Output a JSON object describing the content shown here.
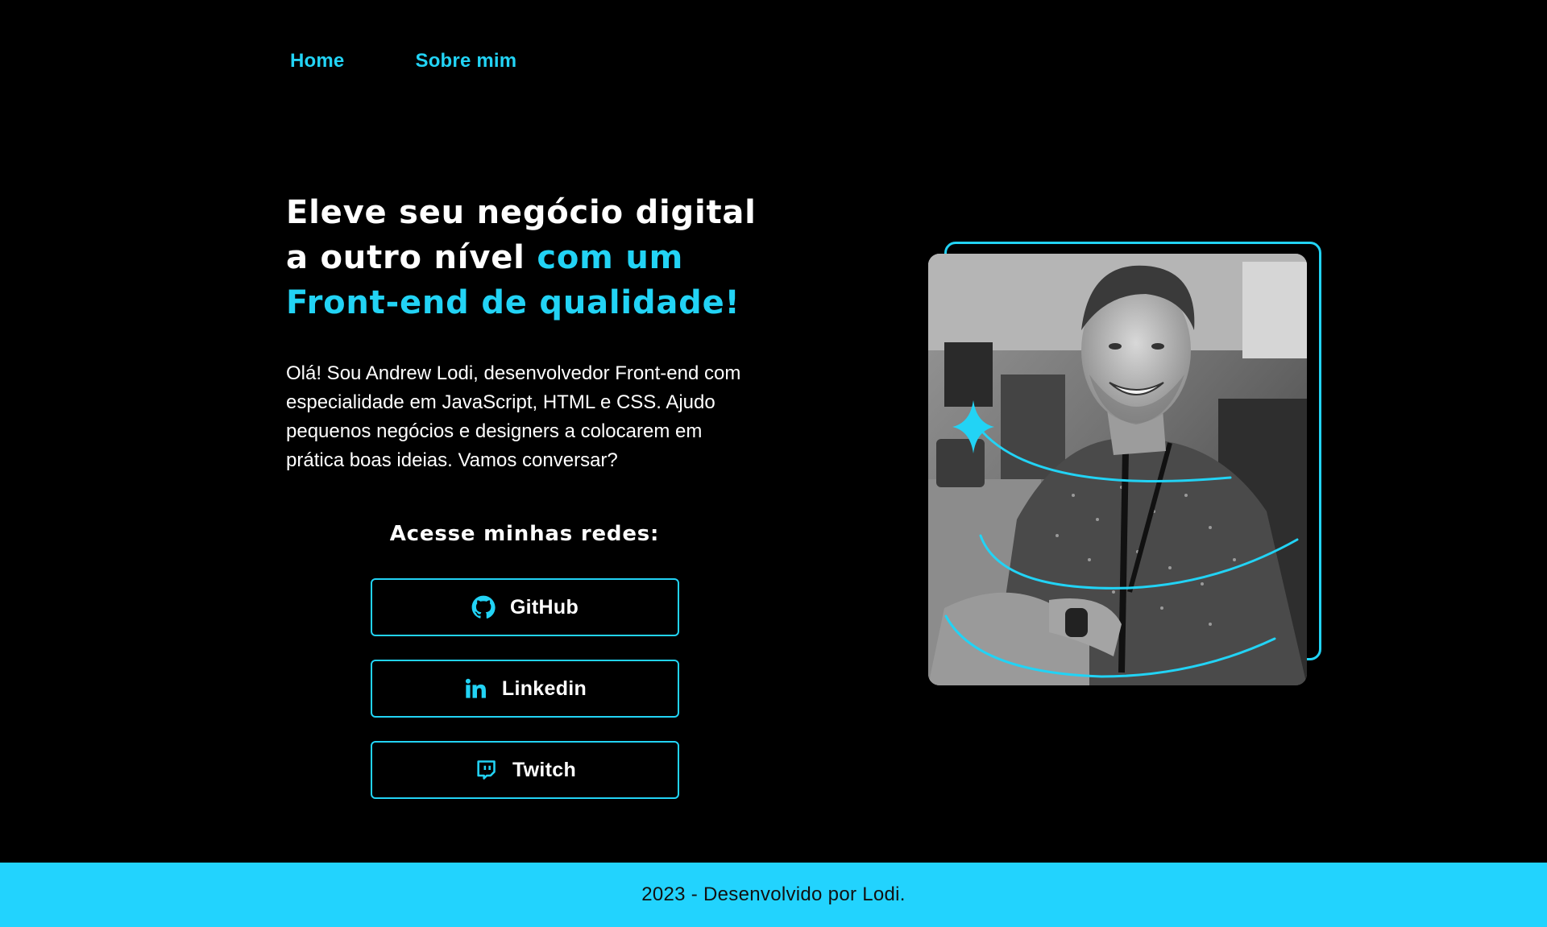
{
  "nav": {
    "items": [
      {
        "label": "Home"
      },
      {
        "label": "Sobre mim"
      }
    ]
  },
  "hero": {
    "headline_line1": "Eleve seu negócio digital",
    "headline_line2_white": "a outro nível ",
    "headline_line2_accent": "com um",
    "headline_line3_accent": "Front-end de qualidade!",
    "intro": "Olá! Sou Andrew Lodi, desenvolvedor Front-end com especialidade em JavaScript, HTML e CSS. Ajudo pequenos negócios e designers a colocarem em prática boas ideias. Vamos conversar?"
  },
  "social": {
    "title": "Acesse minhas redes:",
    "buttons": [
      {
        "label": "GitHub",
        "icon": "github-icon"
      },
      {
        "label": "Linkedin",
        "icon": "linkedin-icon"
      },
      {
        "label": "Twitch",
        "icon": "twitch-icon"
      }
    ]
  },
  "photo": {
    "alt": "Andrew Lodi"
  },
  "footer": {
    "text": "2023 - Desenvolvido por Lodi."
  },
  "colors": {
    "accent": "#22d3f5",
    "background": "#000000",
    "footer_bg": "#22d3fe"
  }
}
